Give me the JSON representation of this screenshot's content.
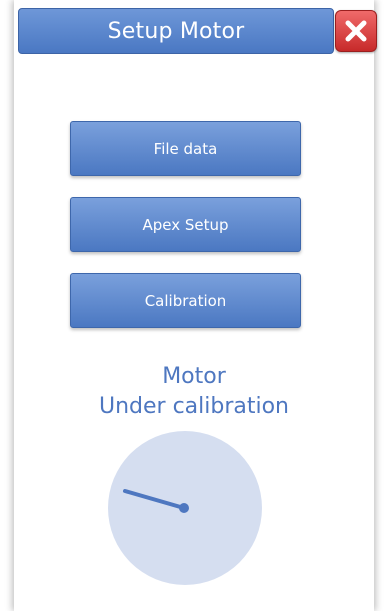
{
  "dialog": {
    "title": "Setup Motor"
  },
  "menu": {
    "file_data_label": "File data",
    "apex_setup_label": "Apex Setup",
    "calibration_label": "Calibration"
  },
  "status": {
    "line1": "Motor",
    "line2": "Under calibration"
  },
  "icons": {
    "close": "close-icon",
    "dial": "calibration-dial-icon"
  },
  "colors": {
    "accent_blue": "#4a78c3",
    "status_text": "#4e77c0",
    "close_red": "#d43a3a",
    "dial_fill": "#d5def0"
  }
}
